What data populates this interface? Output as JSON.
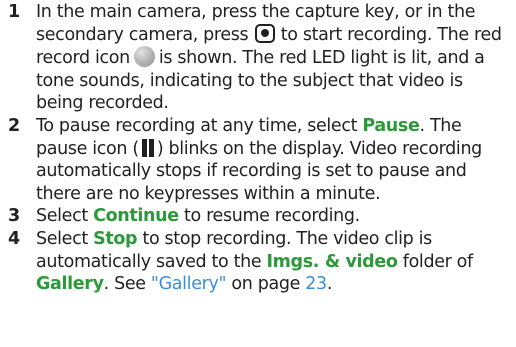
{
  "steps": [
    {
      "number": "1",
      "t1": "In the main camera, press the capture key, or in the secondary camera, press",
      "t2": "to start recording. The red record icon",
      "t3": "is shown. The red LED light is lit, and a tone sounds, indicating to the subject that video is being recorded."
    },
    {
      "number": "2",
      "t1": "To pause recording at any time, select",
      "pause_label": "Pause",
      "t2": ". The pause icon (",
      "t3": ") blinks on the display. Video recording automatically stops if recording is set to pause and there are no keypresses within a minute."
    },
    {
      "number": "3",
      "t1": "Select",
      "continue_label": "Continue",
      "t2": "to resume recording."
    },
    {
      "number": "4",
      "t1": "Select",
      "stop_label": "Stop",
      "t2": "to stop recording. The video clip is automatically saved to the",
      "folder_label": "Imgs. & video",
      "t3": "folder of",
      "gallery_label": "Gallery",
      "t4": ". See",
      "ref_text": "\"Gallery\"",
      "t5": "on page",
      "page_number": "23",
      "t6": "."
    }
  ],
  "icons": {
    "capture_key": "camera-capture-key-icon",
    "record": "record-icon",
    "pause": "pause-icon"
  },
  "colors": {
    "text": "#231f20",
    "highlight_green": "#2c9a3a",
    "link_blue": "#3a8fd6"
  }
}
